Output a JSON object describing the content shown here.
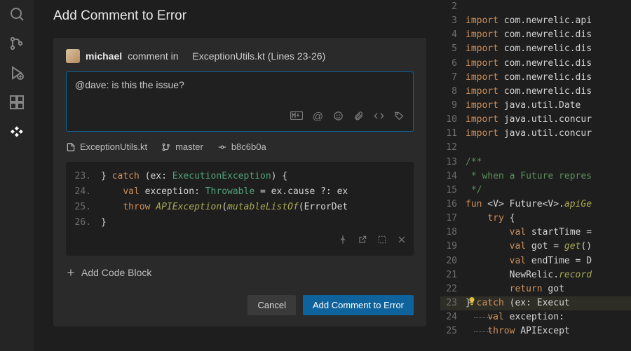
{
  "panel": {
    "title": "Add Comment to Error",
    "author": "michael",
    "comment_verb": "comment in",
    "context": "ExceptionUtils.kt (Lines 23-26)",
    "comment_text": "@dave: is this the issue?",
    "meta": {
      "file": "ExceptionUtils.kt",
      "branch": "master",
      "commit": "b8c6b0a"
    },
    "code": {
      "lines": [
        {
          "n": "23.",
          "html": "} <span class='kw'>catch</span> (ex: <span class='ty'>ExecutionException</span>) {"
        },
        {
          "n": "24.",
          "html": "    <span class='kw'>val</span> exception: <span class='ty'>Throwable</span> = ex.cause ?: ex"
        },
        {
          "n": "25.",
          "html": "    <span class='kw'>throw</span> <span class='fn'>APIException</span>(<span class='fn'>mutableListOf</span>(ErrorDet"
        },
        {
          "n": "26.",
          "html": "}"
        }
      ]
    },
    "add_block_label": "Add Code Block",
    "cancel_label": "Cancel",
    "submit_label": "Add Comment to Error"
  },
  "editor": {
    "lines": [
      {
        "n": "2",
        "html": ""
      },
      {
        "n": "3",
        "html": "<span class='kw'>import</span> com.newrelic.api"
      },
      {
        "n": "4",
        "html": "<span class='kw'>import</span> com.newrelic.dis"
      },
      {
        "n": "5",
        "html": "<span class='kw'>import</span> com.newrelic.dis"
      },
      {
        "n": "6",
        "html": "<span class='kw'>import</span> com.newrelic.dis"
      },
      {
        "n": "7",
        "html": "<span class='kw'>import</span> com.newrelic.dis"
      },
      {
        "n": "8",
        "html": "<span class='kw'>import</span> com.newrelic.dis"
      },
      {
        "n": "9",
        "html": "<span class='kw'>import</span> java.util.Date"
      },
      {
        "n": "10",
        "html": "<span class='kw'>import</span> java.util.concur"
      },
      {
        "n": "11",
        "html": "<span class='kw'>import</span> java.util.concur"
      },
      {
        "n": "12",
        "html": ""
      },
      {
        "n": "13",
        "html": "<span class='cm'>/**</span>"
      },
      {
        "n": "14",
        "html": "<span class='cm'> * when a Future repres</span>"
      },
      {
        "n": "15",
        "html": "<span class='cm'> */</span>"
      },
      {
        "n": "16",
        "html": "<span class='kw'>fun</span> &lt;V&gt; Future&lt;V&gt;.<span class='fn'>apiGe</span>"
      },
      {
        "n": "17",
        "html": "    <span class='kw'>try</span> {"
      },
      {
        "n": "18",
        "html": "        <span class='kw'>val</span> startTime ="
      },
      {
        "n": "19",
        "html": "        <span class='kw'>val</span> got = <span class='fn'>get</span>()"
      },
      {
        "n": "20",
        "html": "        <span class='kw'>val</span> endTime = D"
      },
      {
        "n": "21",
        "html": "        NewRelic.<span class='fn'>record</span>"
      },
      {
        "n": "22",
        "html": "        <span class='kw'>return</span> got"
      },
      {
        "n": "23",
        "html": "} <span class='kw'>catch</span> (ex: Execut",
        "hl": true,
        "bulb": true
      },
      {
        "n": "24",
        "html": "    <span class='kw'>val</span> exception: ",
        "dim": true
      },
      {
        "n": "25",
        "html": "    <span class='kw'>throw</span> APIExcept",
        "dim": true
      }
    ]
  }
}
